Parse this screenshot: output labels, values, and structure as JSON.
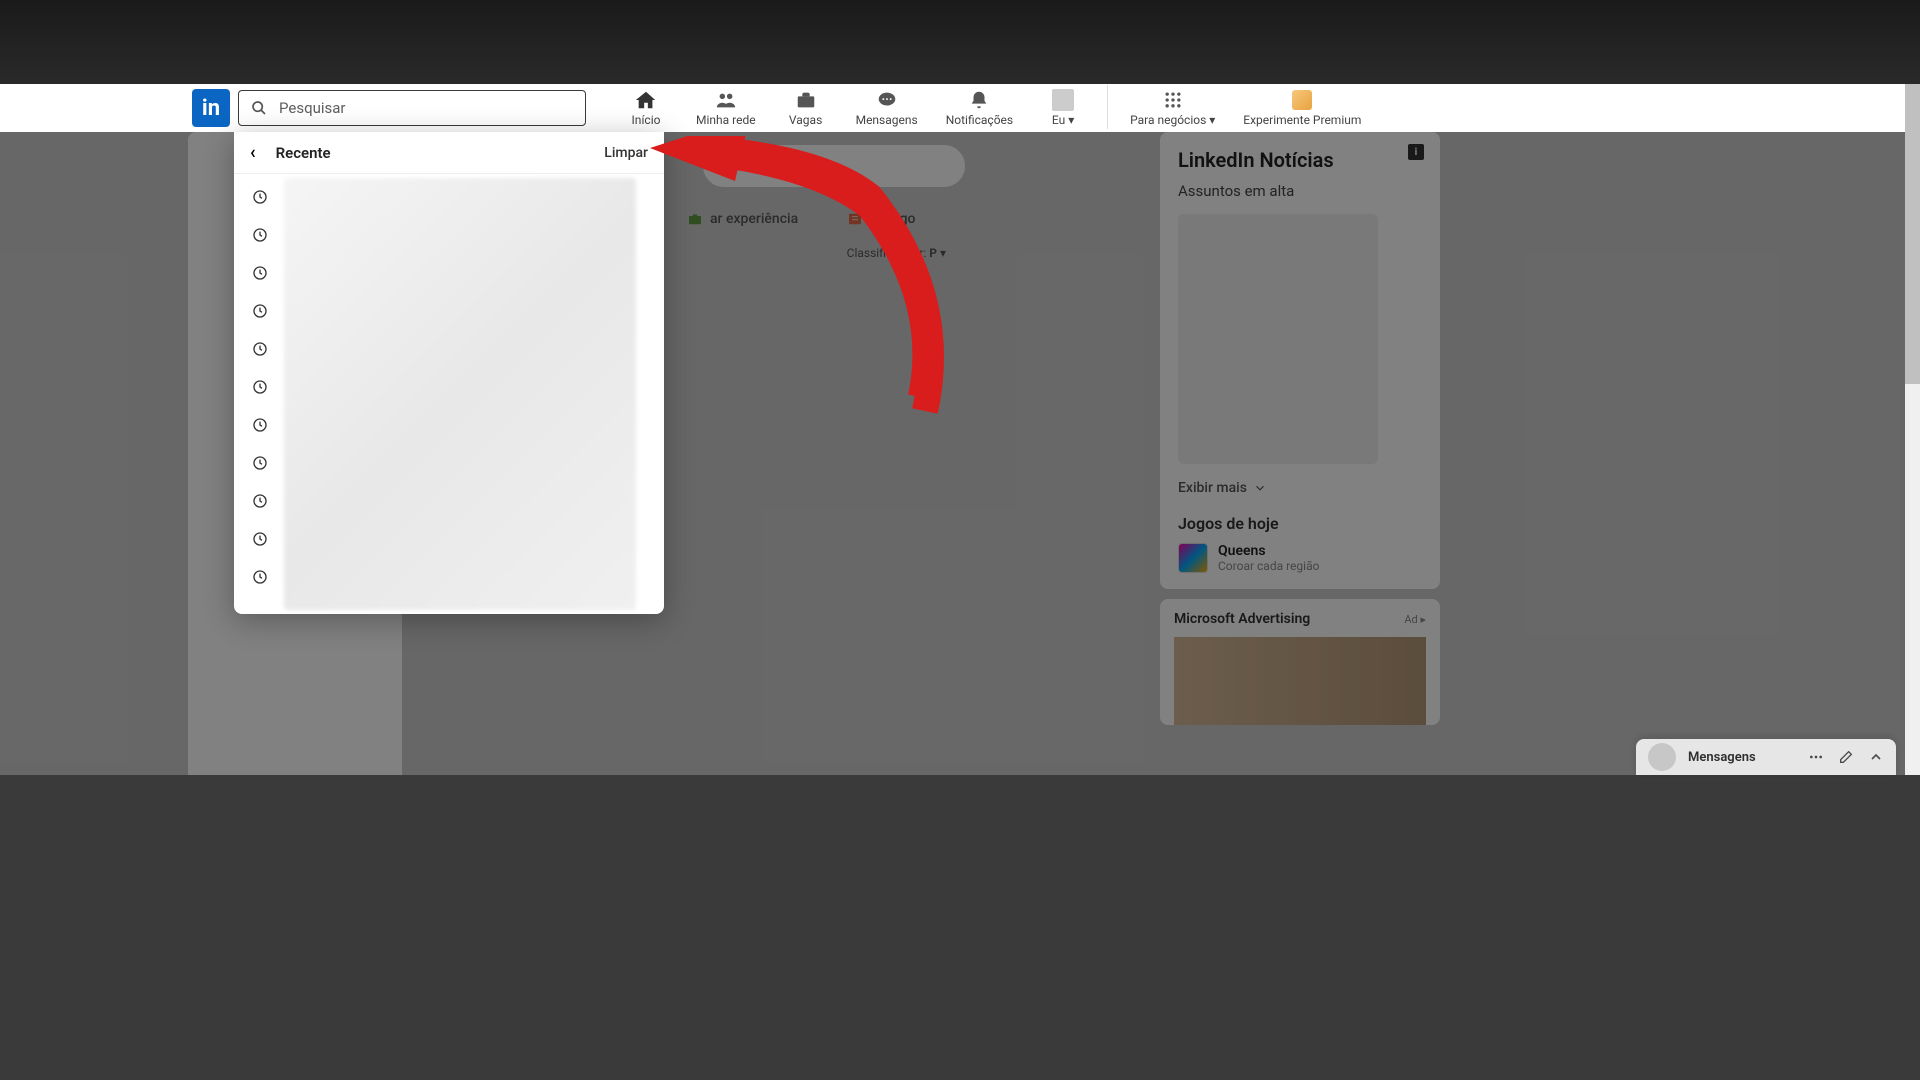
{
  "logo": "in",
  "search": {
    "placeholder": "Pesquisar"
  },
  "nav": {
    "home": "Início",
    "network": "Minha rede",
    "jobs": "Vagas",
    "messaging": "Mensagens",
    "notifications": "Notificações",
    "me": "Eu",
    "business": "Para negócios",
    "premium": "Experimente Premium"
  },
  "dropdown": {
    "title": "Recente",
    "clear": "Limpar"
  },
  "feed": {
    "add_experience": "ar experiência",
    "write_article": "Esc             igo",
    "sort_label": "Classificar por:",
    "sort_value": "P"
  },
  "news": {
    "title": "LinkedIn Notícias",
    "subtitle": "Assuntos em alta",
    "show_more": "Exibir mais"
  },
  "games": {
    "title": "Jogos de hoje",
    "game1_name": "Queens",
    "game1_desc": "Coroar cada região"
  },
  "ad": {
    "title": "Microsoft Advertising",
    "badge": "Ad"
  },
  "messaging_dock": "Mensagens"
}
